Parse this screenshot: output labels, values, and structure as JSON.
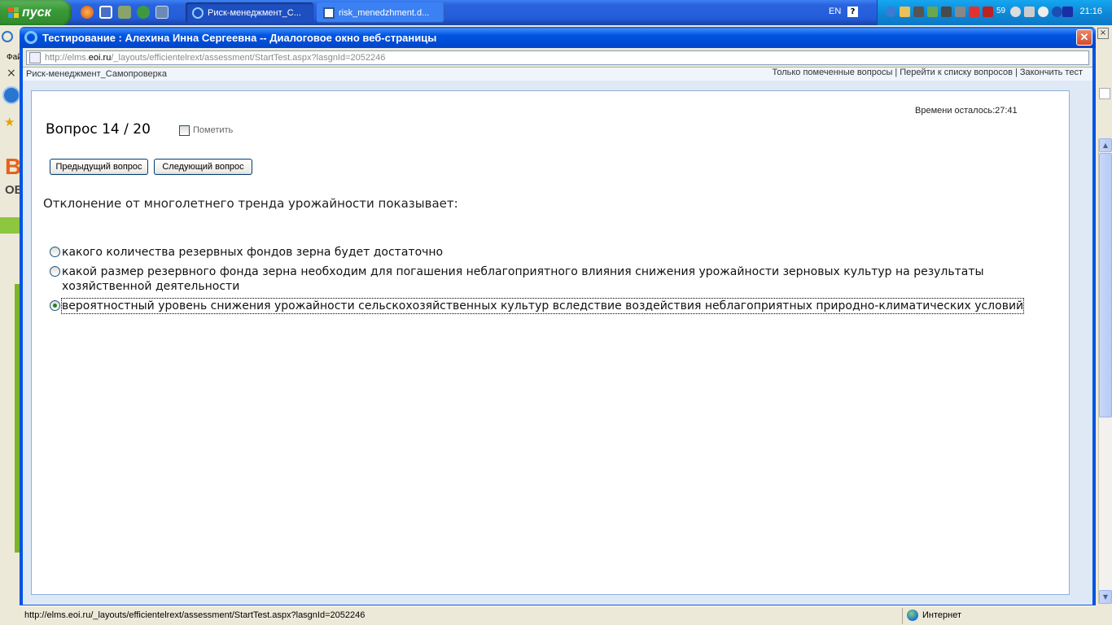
{
  "taskbar": {
    "start_label": "пуск",
    "tasks": [
      {
        "label": "Риск-менеджмент_С...",
        "active": true
      },
      {
        "label": "risk_menedzhment.d...",
        "active": false
      }
    ],
    "language": "EN",
    "tray_counter": "59",
    "clock": "21:16"
  },
  "dialog": {
    "title": "Тестирование : Алехина Инна Сергеевна -- Диалоговое окно веб-страницы",
    "address": {
      "prefix": "http://elms.",
      "domain": "eoi.ru",
      "suffix": "/_layouts/efficientelrext/assessment/StartTest.aspx?lasgnId=2052246"
    }
  },
  "course": {
    "name": "Риск-менеджмент_Самопроверка"
  },
  "top_links": {
    "marked_only": "Только помеченные вопросы",
    "to_list": "Перейти к списку вопросов",
    "finish": "Закончить тест",
    "separator": "|"
  },
  "timer": {
    "text": "Времени осталось:27:41"
  },
  "question": {
    "title": "Вопрос 14 / 20",
    "mark_label": "Пометить",
    "prev_label": "Предыдущий вопрос",
    "next_label": "Следующий вопрос",
    "text": "Отклонение от многолетнего тренда урожайности показывает:",
    "answers": [
      {
        "text": "какого количества резервных фондов зерна будет достаточно",
        "selected": false
      },
      {
        "text": "какой размер резервного фонда зерна необходим для погашения неблагоприятного влияния снижения урожайности зерновых культур на результаты хозяйственной деятельности",
        "selected": false
      },
      {
        "text": "вероятностный уровень снижения урожайности сельскохозяйственных культур вследствие воздействия неблагоприятных природно-климатических условий",
        "selected": true
      }
    ]
  },
  "statusbar": {
    "url": "http://elms.eoi.ru/_layouts/efficientelrext/assessment/StartTest.aspx?lasgnId=2052246",
    "zone": "Интернет"
  },
  "background_window": {
    "menu_fragment": "Фай",
    "logo_fragment_1": "B",
    "logo_fragment_2": "ОБ"
  },
  "colors": {
    "taskbar": "#245ddb",
    "start_button": "#3a9a38",
    "title_bar": "#0054e3",
    "selected_radio": "#217f21"
  }
}
